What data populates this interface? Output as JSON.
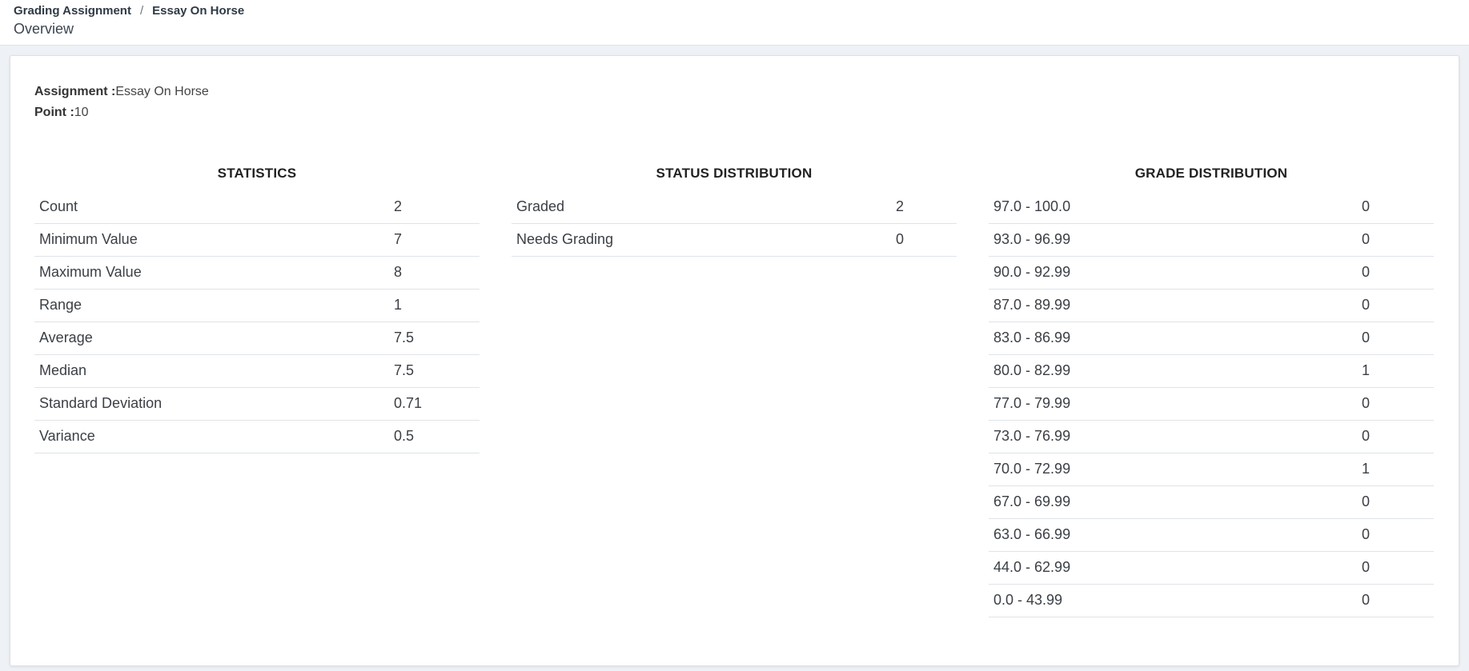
{
  "breadcrumb": {
    "items": [
      "Grading Assignment",
      "Essay On Horse"
    ],
    "separator": "/"
  },
  "page_title": "Overview",
  "assignment": {
    "assignment_label": "Assignment :",
    "assignment_value": "Essay On Horse",
    "point_label": "Point :",
    "point_value": "10"
  },
  "statistics": {
    "title": "STATISTICS",
    "rows": [
      {
        "label": "Count",
        "value": "2"
      },
      {
        "label": "Minimum Value",
        "value": "7"
      },
      {
        "label": "Maximum Value",
        "value": "8"
      },
      {
        "label": "Range",
        "value": "1"
      },
      {
        "label": "Average",
        "value": "7.5"
      },
      {
        "label": "Median",
        "value": "7.5"
      },
      {
        "label": "Standard Deviation",
        "value": "0.71"
      },
      {
        "label": "Variance",
        "value": "0.5"
      }
    ]
  },
  "status_distribution": {
    "title": "STATUS DISTRIBUTION",
    "rows": [
      {
        "label": "Graded",
        "value": "2"
      },
      {
        "label": "Needs Grading",
        "value": "0"
      }
    ]
  },
  "grade_distribution": {
    "title": "GRADE DISTRIBUTION",
    "rows": [
      {
        "label": "97.0 - 100.0",
        "value": "0"
      },
      {
        "label": "93.0 - 96.99",
        "value": "0"
      },
      {
        "label": "90.0 - 92.99",
        "value": "0"
      },
      {
        "label": "87.0 - 89.99",
        "value": "0"
      },
      {
        "label": "83.0 - 86.99",
        "value": "0"
      },
      {
        "label": "80.0 - 82.99",
        "value": "1"
      },
      {
        "label": "77.0 - 79.99",
        "value": "0"
      },
      {
        "label": "73.0 - 76.99",
        "value": "0"
      },
      {
        "label": "70.0 - 72.99",
        "value": "1"
      },
      {
        "label": "67.0 - 69.99",
        "value": "0"
      },
      {
        "label": "63.0 - 66.99",
        "value": "0"
      },
      {
        "label": "44.0 - 62.99",
        "value": "0"
      },
      {
        "label": "0.0 - 43.99",
        "value": "0"
      }
    ]
  }
}
